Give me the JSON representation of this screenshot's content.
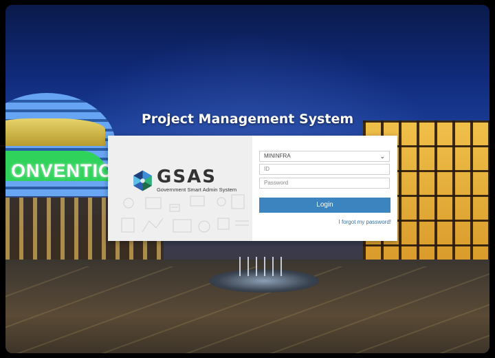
{
  "page": {
    "title": "Project Management System"
  },
  "scene": {
    "building_sign": "ONVENTION"
  },
  "logo": {
    "word": "GSAS",
    "subtitle": "Government Smart Admin System",
    "icon": "gsas-hexagon-icon"
  },
  "form": {
    "organization": {
      "selected": "MININFRA",
      "icon": "chevron-down-icon"
    },
    "id_placeholder": "ID",
    "password_placeholder": "Password",
    "login_label": "Login",
    "forgot_label": "I forgot my password!"
  },
  "colors": {
    "accent": "#3b84bf",
    "link": "#3b6fa3"
  }
}
